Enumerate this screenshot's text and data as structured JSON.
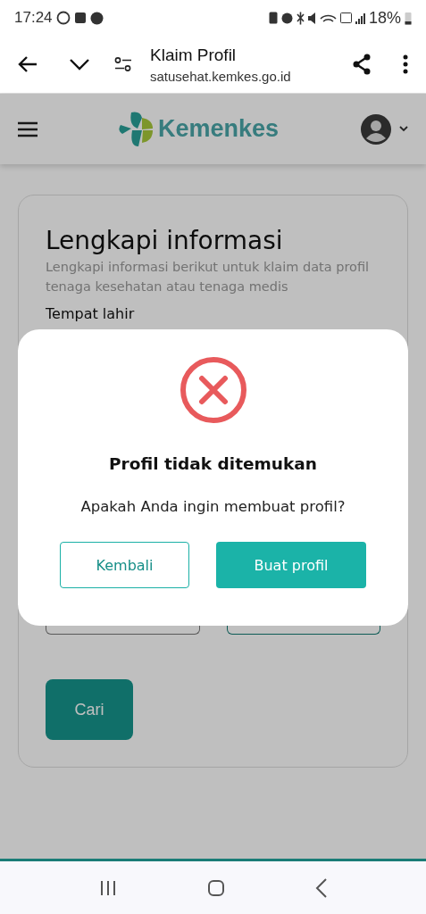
{
  "status_bar": {
    "time": "17:24",
    "battery": "18%"
  },
  "browser": {
    "title": "Klaim Profil",
    "url": "satusehat.kemkes.go.id"
  },
  "header": {
    "logo_text": "Kemenkes"
  },
  "form": {
    "title": "Lengkapi informasi",
    "subtitle": "Lengkapi informasi berikut untuk klaim data profil tenaga kesehatan atau tenaga medis",
    "field_label": "Tempat lahir",
    "submit": "Cari"
  },
  "dialog": {
    "title": "Profil tidak ditemukan",
    "message": "Apakah Anda ingin membuat profil?",
    "buttons": [
      {
        "label": "Kembali",
        "kind": "secondary"
      },
      {
        "label": "Buat profil",
        "kind": "primary"
      }
    ]
  }
}
